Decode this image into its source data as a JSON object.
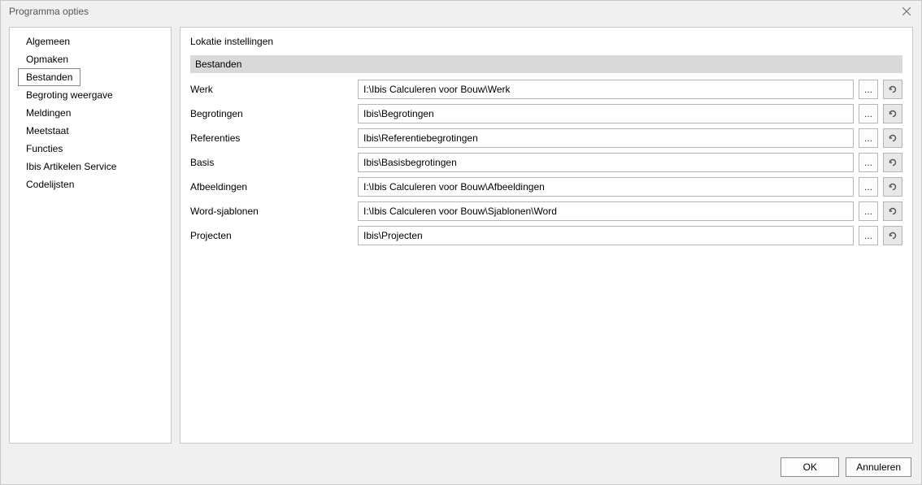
{
  "window": {
    "title": "Programma opties"
  },
  "sidebar": {
    "items": [
      {
        "label": "Algemeen"
      },
      {
        "label": "Opmaken"
      },
      {
        "label": "Bestanden",
        "selected": true
      },
      {
        "label": "Begroting weergave"
      },
      {
        "label": "Meldingen"
      },
      {
        "label": "Meetstaat"
      },
      {
        "label": "Functies"
      },
      {
        "label": "Ibis Artikelen Service"
      },
      {
        "label": "Codelijsten"
      }
    ]
  },
  "main": {
    "title": "Lokatie instellingen",
    "section_header": "Bestanden",
    "rows": [
      {
        "label": "Werk",
        "value": "I:\\Ibis Calculeren voor Bouw\\Werk"
      },
      {
        "label": "Begrotingen",
        "value": "Ibis\\Begrotingen"
      },
      {
        "label": "Referenties",
        "value": "Ibis\\Referentiebegrotingen"
      },
      {
        "label": "Basis",
        "value": "Ibis\\Basisbegrotingen"
      },
      {
        "label": "Afbeeldingen",
        "value": "I:\\Ibis Calculeren voor Bouw\\Afbeeldingen"
      },
      {
        "label": "Word-sjablonen",
        "value": "I:\\Ibis Calculeren voor Bouw\\Sjablonen\\Word"
      },
      {
        "label": "Projecten",
        "value": "Ibis\\Projecten"
      }
    ],
    "browse_label": "...",
    "reset_tooltip": "Reset"
  },
  "footer": {
    "ok": "OK",
    "cancel": "Annuleren"
  }
}
